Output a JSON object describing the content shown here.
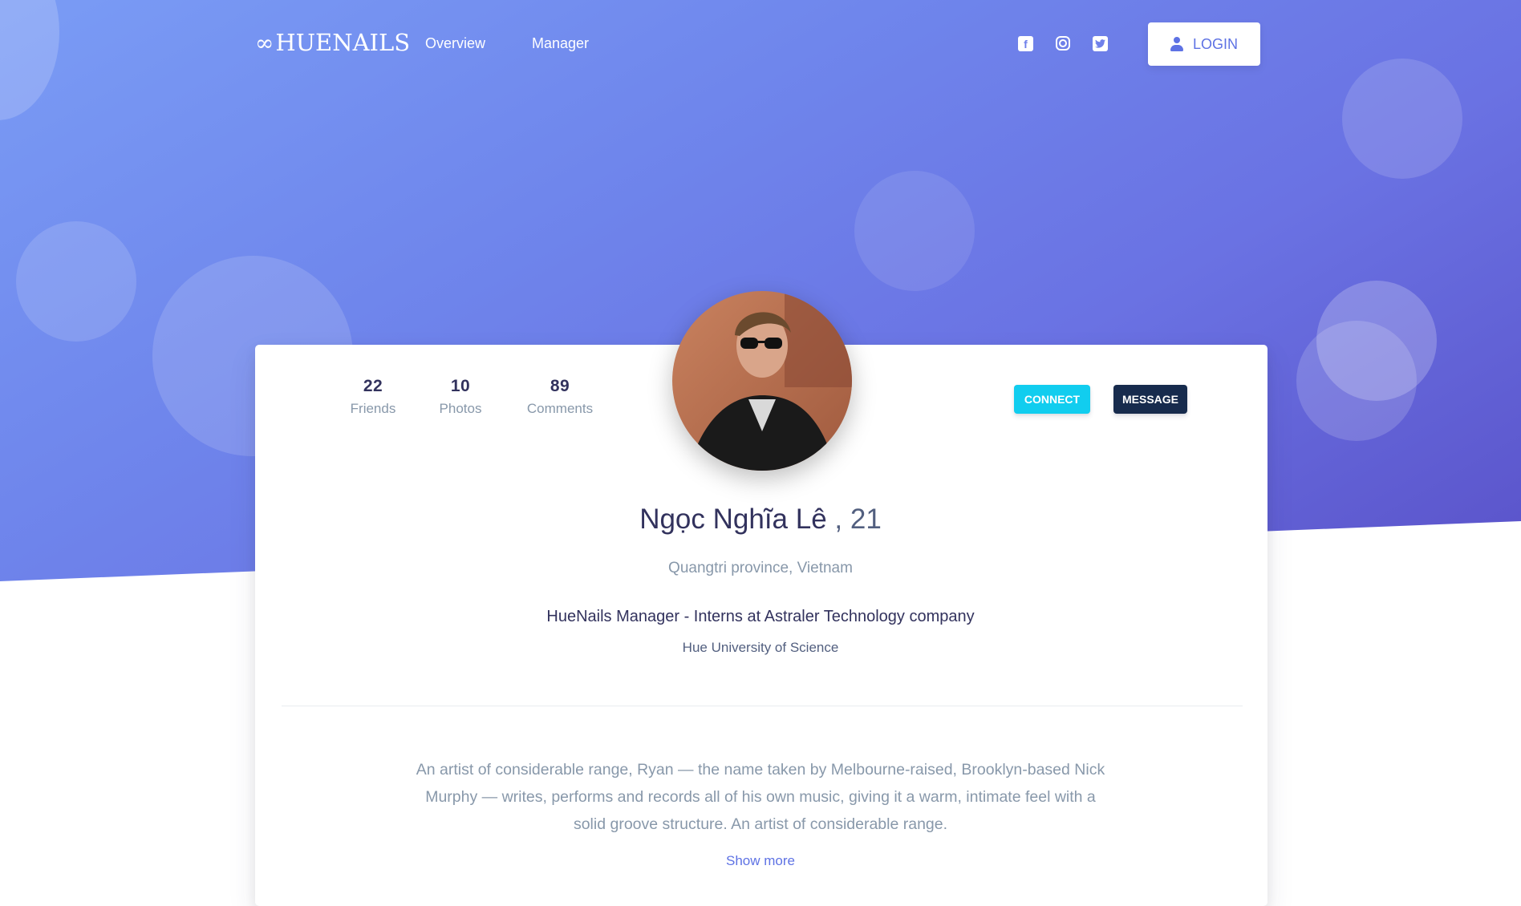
{
  "navbar": {
    "brand": "HUENAILS",
    "links": [
      {
        "label": "Overview"
      },
      {
        "label": "Manager"
      }
    ],
    "social_icons": [
      "facebook-icon",
      "instagram-icon",
      "twitter-icon"
    ],
    "login_label": "LOGIN"
  },
  "profile": {
    "stats": [
      {
        "value": "22",
        "label": "Friends"
      },
      {
        "value": "10",
        "label": "Photos"
      },
      {
        "value": "89",
        "label": "Comments"
      }
    ],
    "connect_label": "CONNECT",
    "message_label": "MESSAGE",
    "name": "Ngọc Nghĩa Lê",
    "age": ", 21",
    "location": "Quangtri province, Vietnam",
    "job": "HueNails Manager - Interns at Astraler Technology company",
    "school": "Hue University of Science",
    "bio": "An artist of considerable range, Ryan — the name taken by Melbourne-raised, Brooklyn-based Nick Murphy — writes, performs and records all of his own music, giving it a warm, intimate feel with a solid groove structure. An artist of considerable range.",
    "show_more_label": "Show more"
  },
  "colors": {
    "primary": "#5e72e4",
    "info": "#11cdef",
    "dark": "#172b4d",
    "gradient_start": "#7a9cf5",
    "gradient_end": "#5a52c9"
  }
}
